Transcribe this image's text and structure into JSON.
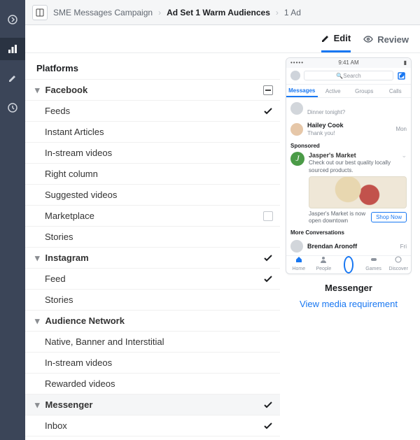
{
  "breadcrumb": {
    "campaign": "SME Messages Campaign",
    "adset": "Ad Set 1 Warm Audiences",
    "ad": "1 Ad"
  },
  "tabs": {
    "edit": "Edit",
    "review": "Review"
  },
  "panel": {
    "title": "Platforms"
  },
  "placements": {
    "facebook": {
      "label": "Facebook",
      "feeds": "Feeds",
      "instant_articles": "Instant Articles",
      "instream": "In-stream videos",
      "right_column": "Right column",
      "suggested": "Suggested videos",
      "marketplace": "Marketplace",
      "stories": "Stories"
    },
    "instagram": {
      "label": "Instagram",
      "feed": "Feed",
      "stories": "Stories"
    },
    "audience_network": {
      "label": "Audience Network",
      "native": "Native, Banner and Interstitial",
      "instream": "In-stream videos",
      "rewarded": "Rewarded videos"
    },
    "messenger": {
      "label": "Messenger",
      "inbox": "Inbox"
    }
  },
  "preview": {
    "time": "9:41 AM",
    "search_placeholder": "Search",
    "tabs": {
      "messages": "Messages",
      "active": "Active",
      "groups": "Groups",
      "calls": "Calls"
    },
    "row1": {
      "name": "",
      "sub": "Dinner tonight?",
      "time": ""
    },
    "row2": {
      "name": "Hailey Cook",
      "sub": "Thank you!",
      "time": "Mon"
    },
    "sponsored_label": "Sponsored",
    "sponsor": {
      "name": "Jasper's Market",
      "desc": "Check out our best quality locally sourced products.",
      "footer": "Jasper's Market is now open downtown",
      "cta": "Shop Now"
    },
    "more_label": "More Conversations",
    "row3": {
      "name": "Brendan Aronoff",
      "time": "Fri"
    },
    "bottom": {
      "home": "Home",
      "people": "People",
      "games": "Games",
      "discover": "Discover"
    },
    "caption": "Messenger",
    "link": "View media requirement"
  }
}
